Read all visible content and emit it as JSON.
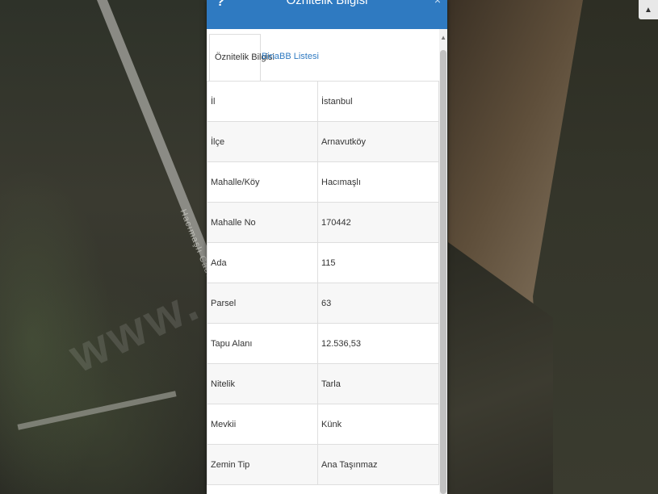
{
  "panel": {
    "title": "Öznitelik Bilgisi",
    "help_icon": "?",
    "close_icon": "×",
    "tabs": [
      {
        "label": "Öznitelik Bilgisi",
        "active": true
      },
      {
        "label": "BinaBB Listesi",
        "active": false
      }
    ],
    "rows": [
      {
        "key": "İl",
        "value": "İstanbul"
      },
      {
        "key": "İlçe",
        "value": "Arnavutköy"
      },
      {
        "key": "Mahalle/Köy",
        "value": "Hacımaşlı"
      },
      {
        "key": "Mahalle No",
        "value": "170442"
      },
      {
        "key": "Ada",
        "value": "115"
      },
      {
        "key": "Parsel",
        "value": "63"
      },
      {
        "key": "Tapu Alanı",
        "value": "12.536,53"
      },
      {
        "key": "Nitelik",
        "value": "Tarla"
      },
      {
        "key": "Mevkii",
        "value": "Künk"
      },
      {
        "key": "Zemin Tip",
        "value": "Ana Taşınmaz"
      }
    ]
  },
  "map": {
    "road_label": "Hacımaşlı Cadde",
    "watermark": "www.      a.net.tr"
  },
  "colors": {
    "accent": "#2f7ac1"
  }
}
